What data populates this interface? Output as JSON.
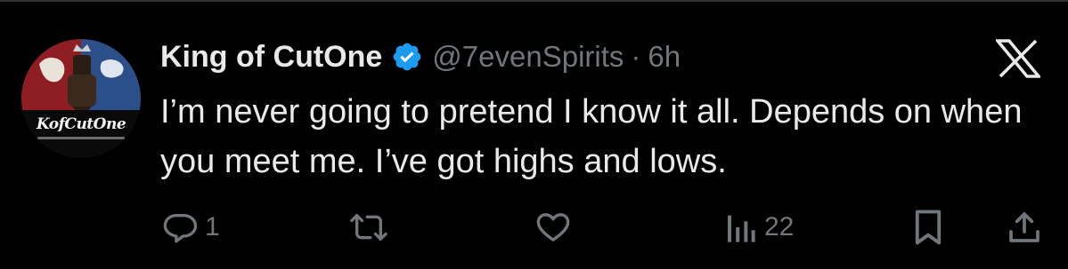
{
  "tweet": {
    "display_name": "King of CutOne",
    "handle": "@7evenSpirits",
    "separator": "·",
    "time": "6h",
    "text": "I’m never going to pretend I know it all. Depends on when you meet me. I’ve got highs and lows.",
    "avatar_text": "KofCutOne"
  },
  "actions": {
    "reply_count": "1",
    "views_count": "22"
  },
  "icons": {
    "verified": "verified-badge-icon",
    "x_logo": "x-logo-icon",
    "reply": "reply-icon",
    "retweet": "retweet-icon",
    "like": "heart-icon",
    "views": "views-icon",
    "bookmark": "bookmark-icon",
    "share": "share-icon"
  },
  "colors": {
    "background": "#000000",
    "primary_text": "#e7e9ea",
    "secondary_text": "#71767b",
    "verified_blue": "#1d9bf0"
  }
}
